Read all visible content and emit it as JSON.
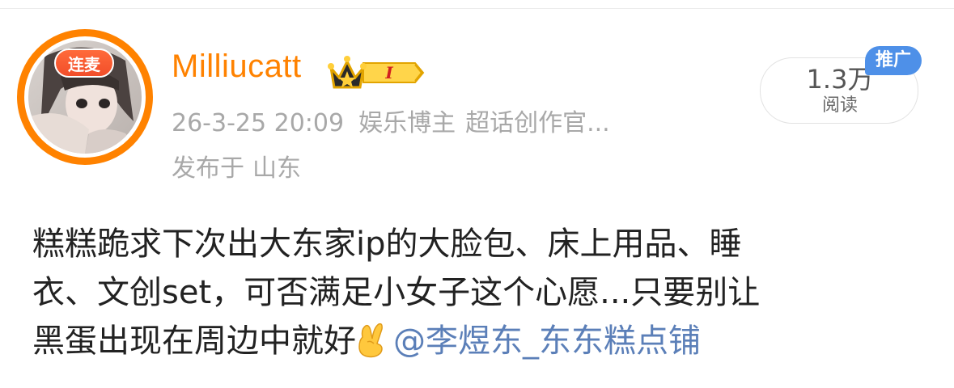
{
  "post": {
    "author": {
      "avatar_badge": "连麦",
      "name": "Milliucatt",
      "level_badge": "I"
    },
    "meta": {
      "date": "26-3-25 20:09",
      "tag1": "娱乐博主",
      "tag2": "超话创作官...",
      "location_prefix": "发布于",
      "location": "山东"
    },
    "stats": {
      "read_count": "1.3万",
      "read_label": "阅读",
      "promo_label": "推广"
    },
    "body": {
      "line1": "糕糕跪求下次出大东家ip的大脸包、床上用品、睡",
      "line2": "衣、文创set，可否满足小女子这个心愿...只要别让",
      "line3_text": "黑蛋出现在周边中就好",
      "mention": "@李煜东_东东糕点铺"
    }
  },
  "colors": {
    "accent": "#ff8200",
    "mention": "#5b7fb8",
    "meta_gray": "#a8a8a8",
    "promo_blue": "#4e90e8",
    "live_red": "#f24e2a"
  },
  "icons": {
    "avatar": "user-avatar-photo",
    "crown": "crown-icon",
    "emoji": "crossed-fingers-emoji"
  }
}
